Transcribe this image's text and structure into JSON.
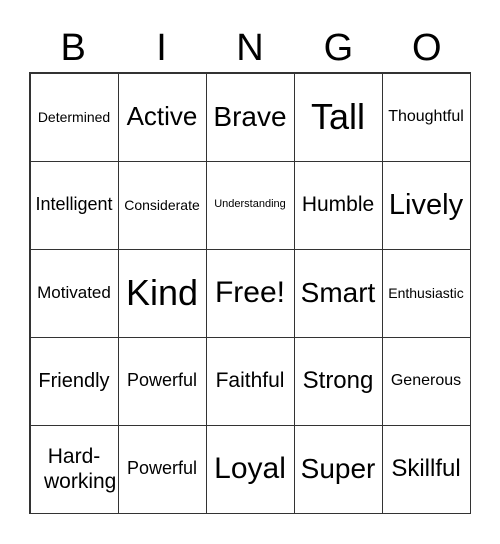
{
  "header": [
    "B",
    "I",
    "N",
    "G",
    "O"
  ],
  "cells": [
    {
      "t": "Determined",
      "s": 14
    },
    {
      "t": "Active",
      "s": 26
    },
    {
      "t": "Brave",
      "s": 28
    },
    {
      "t": "Tall",
      "s": 36
    },
    {
      "t": "Thoughtful",
      "s": 16
    },
    {
      "t": "Intelligent",
      "s": 18
    },
    {
      "t": "Considerate",
      "s": 14
    },
    {
      "t": "Understanding",
      "s": 11
    },
    {
      "t": "Humble",
      "s": 21
    },
    {
      "t": "Lively",
      "s": 29
    },
    {
      "t": "Motivated",
      "s": 17
    },
    {
      "t": "Kind",
      "s": 36
    },
    {
      "t": "Free!",
      "s": 30
    },
    {
      "t": "Smart",
      "s": 28
    },
    {
      "t": "Enthusiastic",
      "s": 14
    },
    {
      "t": "Friendly",
      "s": 20
    },
    {
      "t": "Powerful",
      "s": 18
    },
    {
      "t": "Faithful",
      "s": 21
    },
    {
      "t": "Strong",
      "s": 24
    },
    {
      "t": "Generous",
      "s": 16
    },
    {
      "t": "Hard-working",
      "s": 21,
      "wrap": true
    },
    {
      "t": "Powerful",
      "s": 18
    },
    {
      "t": "Loyal",
      "s": 30
    },
    {
      "t": "Super",
      "s": 28
    },
    {
      "t": "Skillful",
      "s": 24
    }
  ]
}
